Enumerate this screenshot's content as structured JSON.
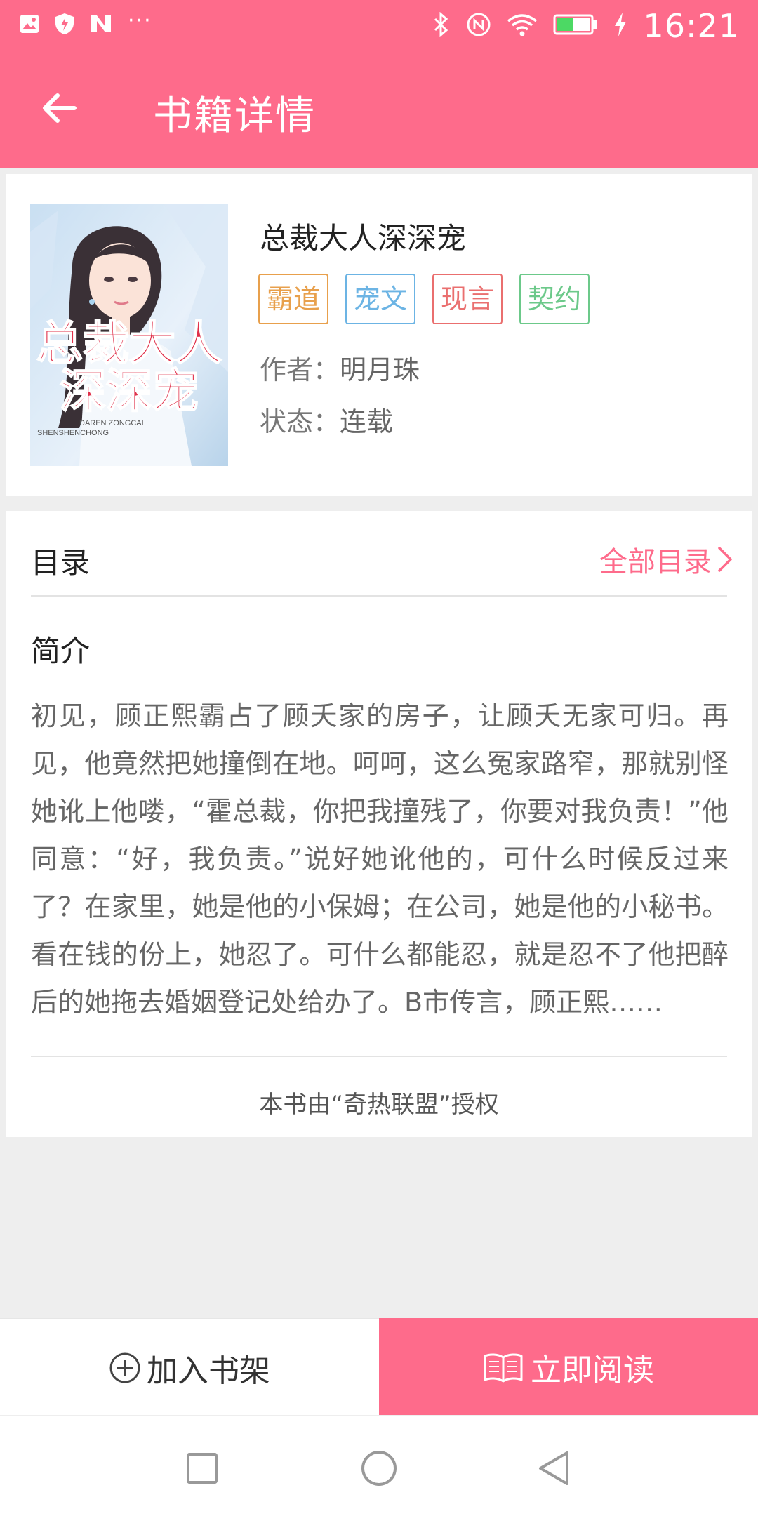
{
  "status_bar": {
    "time": "16:21",
    "left_icons": [
      "image-icon",
      "shield-icon",
      "n-logo-icon",
      "more-dots-icon"
    ],
    "more_dots": "···",
    "right_icons": [
      "bluetooth-icon",
      "nfc-icon",
      "wifi-icon",
      "battery-icon",
      "charging-icon"
    ]
  },
  "header": {
    "back_icon": "arrow-left-icon",
    "title": "书籍详情"
  },
  "book": {
    "title": "总裁大人深深宠",
    "cover_text_line1": "总裁大人",
    "cover_text_line2": "深深宠",
    "cover_pinyin1": "DAREN ZONGCAI",
    "cover_pinyin2": "SHENSHENCHONG",
    "tags": [
      {
        "label": "霸道",
        "color": "#e8a04c"
      },
      {
        "label": "宠文",
        "color": "#6cb4e4"
      },
      {
        "label": "现言",
        "color": "#ea6f6f"
      },
      {
        "label": "契约",
        "color": "#6cc98a"
      }
    ],
    "author_label": "作者：",
    "author": "明月珠",
    "status_label": "状态：",
    "status": "连载"
  },
  "catalog": {
    "label": "目录",
    "link_label": "全部目录",
    "chevron_icon": "chevron-right-icon"
  },
  "intro": {
    "label": "简介",
    "text": "初见，顾正熙霸占了顾夭家的房子，让顾夭无家可归。再见，他竟然把她撞倒在地。呵呵，这么冤家路窄，那就别怪她讹上他喽，“霍总裁，你把我撞残了，你要对我负责！”他同意：“好，我负责。”说好她讹他的，可什么时候反过来了？在家里，她是他的小保姆；在公司，她是他的小秘书。看在钱的份上，她忍了。可什么都能忍，就是忍不了他把醉后的她拖去婚姻登记处给办了。B市传言，顾正熙……"
  },
  "license": "本书由“奇热联盟”授权",
  "actions": {
    "add_shelf_label": "加入书架",
    "add_shelf_icon": "plus-circle-icon",
    "read_now_label": "立即阅读",
    "read_now_icon": "open-book-icon"
  },
  "nav": {
    "recents_icon": "square-icon",
    "home_icon": "circle-icon",
    "back_icon": "triangle-back-icon"
  },
  "colors": {
    "accent": "#fe6b8b",
    "background": "#eeeeee"
  }
}
